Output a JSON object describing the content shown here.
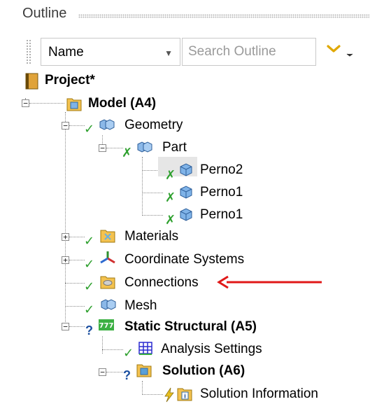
{
  "panel": {
    "title": "Outline"
  },
  "toolbar": {
    "name_combo": "Name",
    "search_placeholder": "Search Outline"
  },
  "tree": {
    "project": "Project*",
    "model": "Model (A4)",
    "geometry": "Geometry",
    "part": "Part",
    "perno2": "Perno2",
    "perno1_a": "Perno1",
    "perno1_b": "Perno1",
    "materials": "Materials",
    "coordinate_systems": "Coordinate Systems",
    "connections": "Connections",
    "mesh": "Mesh",
    "static_structural": "Static Structural (A5)",
    "analysis_settings": "Analysis Settings",
    "solution": "Solution (A6)",
    "solution_information": "Solution Information"
  },
  "colors": {
    "check_green": "#2ea02e",
    "question_blue": "#1b4fa0",
    "annotation_red": "#e01818",
    "folder_yellow": "#f4c24f"
  }
}
